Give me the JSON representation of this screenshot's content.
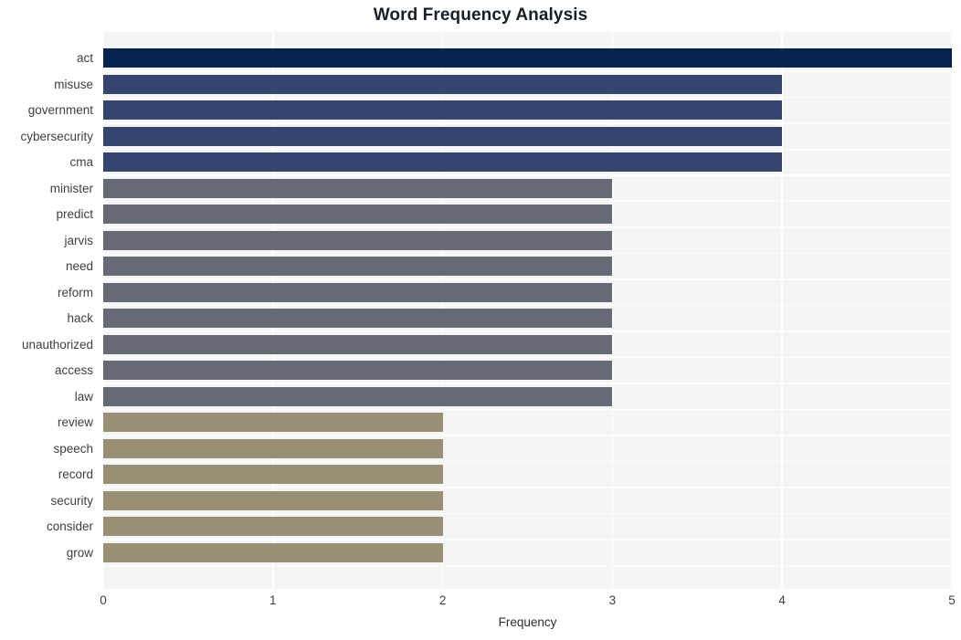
{
  "chart_data": {
    "type": "bar",
    "orientation": "horizontal",
    "title": "Word Frequency Analysis",
    "xlabel": "Frequency",
    "ylabel": "",
    "xlim": [
      0,
      5
    ],
    "xticks": [
      "0",
      "1",
      "2",
      "3",
      "4",
      "5"
    ],
    "xtick_values": [
      0,
      1,
      2,
      3,
      4,
      5
    ],
    "grid": "vertical-white-on-light-gray",
    "legend": "none",
    "categories": [
      "act",
      "misuse",
      "government",
      "cybersecurity",
      "cma",
      "minister",
      "predict",
      "jarvis",
      "need",
      "reform",
      "hack",
      "unauthorized",
      "access",
      "law",
      "review",
      "speech",
      "record",
      "security",
      "consider",
      "grow"
    ],
    "values": [
      5,
      4,
      4,
      4,
      4,
      3,
      3,
      3,
      3,
      3,
      3,
      3,
      3,
      3,
      2,
      2,
      2,
      2,
      2,
      2
    ],
    "bar_colors": [
      "#062450",
      "#344570",
      "#344570",
      "#344570",
      "#344570",
      "#666a75",
      "#666a75",
      "#666a75",
      "#666a75",
      "#666a75",
      "#666a75",
      "#666a75",
      "#666a75",
      "#666a75",
      "#988f74",
      "#988f74",
      "#988f74",
      "#988f74",
      "#988f74",
      "#988f74"
    ]
  },
  "style": {
    "figure_background": "#ffffff",
    "plot_background": "#f5f5f6",
    "gridline_color": "#ffffff",
    "title_color": "#17202a",
    "tick_label_color": "#3f3f3f",
    "axis_label_color": "#2d2d2d"
  }
}
